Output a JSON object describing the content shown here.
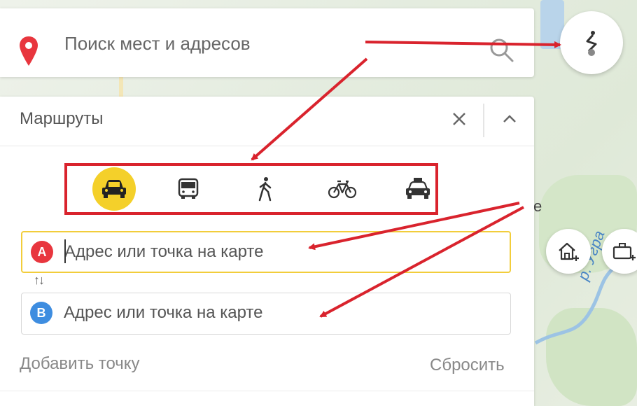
{
  "search": {
    "placeholder": "Поиск мест и адресов"
  },
  "routes": {
    "title": "Маршруты",
    "modes": [
      {
        "name": "car",
        "icon": "car-icon",
        "active": true
      },
      {
        "name": "bus",
        "icon": "bus-icon",
        "active": false
      },
      {
        "name": "walk",
        "icon": "pedestrian-icon",
        "active": false
      },
      {
        "name": "bike",
        "icon": "bicycle-icon",
        "active": false
      },
      {
        "name": "taxi",
        "icon": "taxi-icon",
        "active": false
      }
    ],
    "point_a": {
      "badge": "A",
      "placeholder": "Адрес или точка на карте"
    },
    "point_b": {
      "badge": "B",
      "placeholder": "Адрес или точка на карте"
    },
    "swap_label": "↑↓",
    "add_point_label": "Добавить точку",
    "reset_label": "Сбросить"
  },
  "map": {
    "river_label": "р. Угра",
    "edge_letter": "е"
  },
  "colors": {
    "accent_yellow": "#f4d02a",
    "point_a": "#e8363e",
    "point_b": "#3e8de0",
    "annotation_red": "#d9232d",
    "pin_red": "#e8363e"
  }
}
